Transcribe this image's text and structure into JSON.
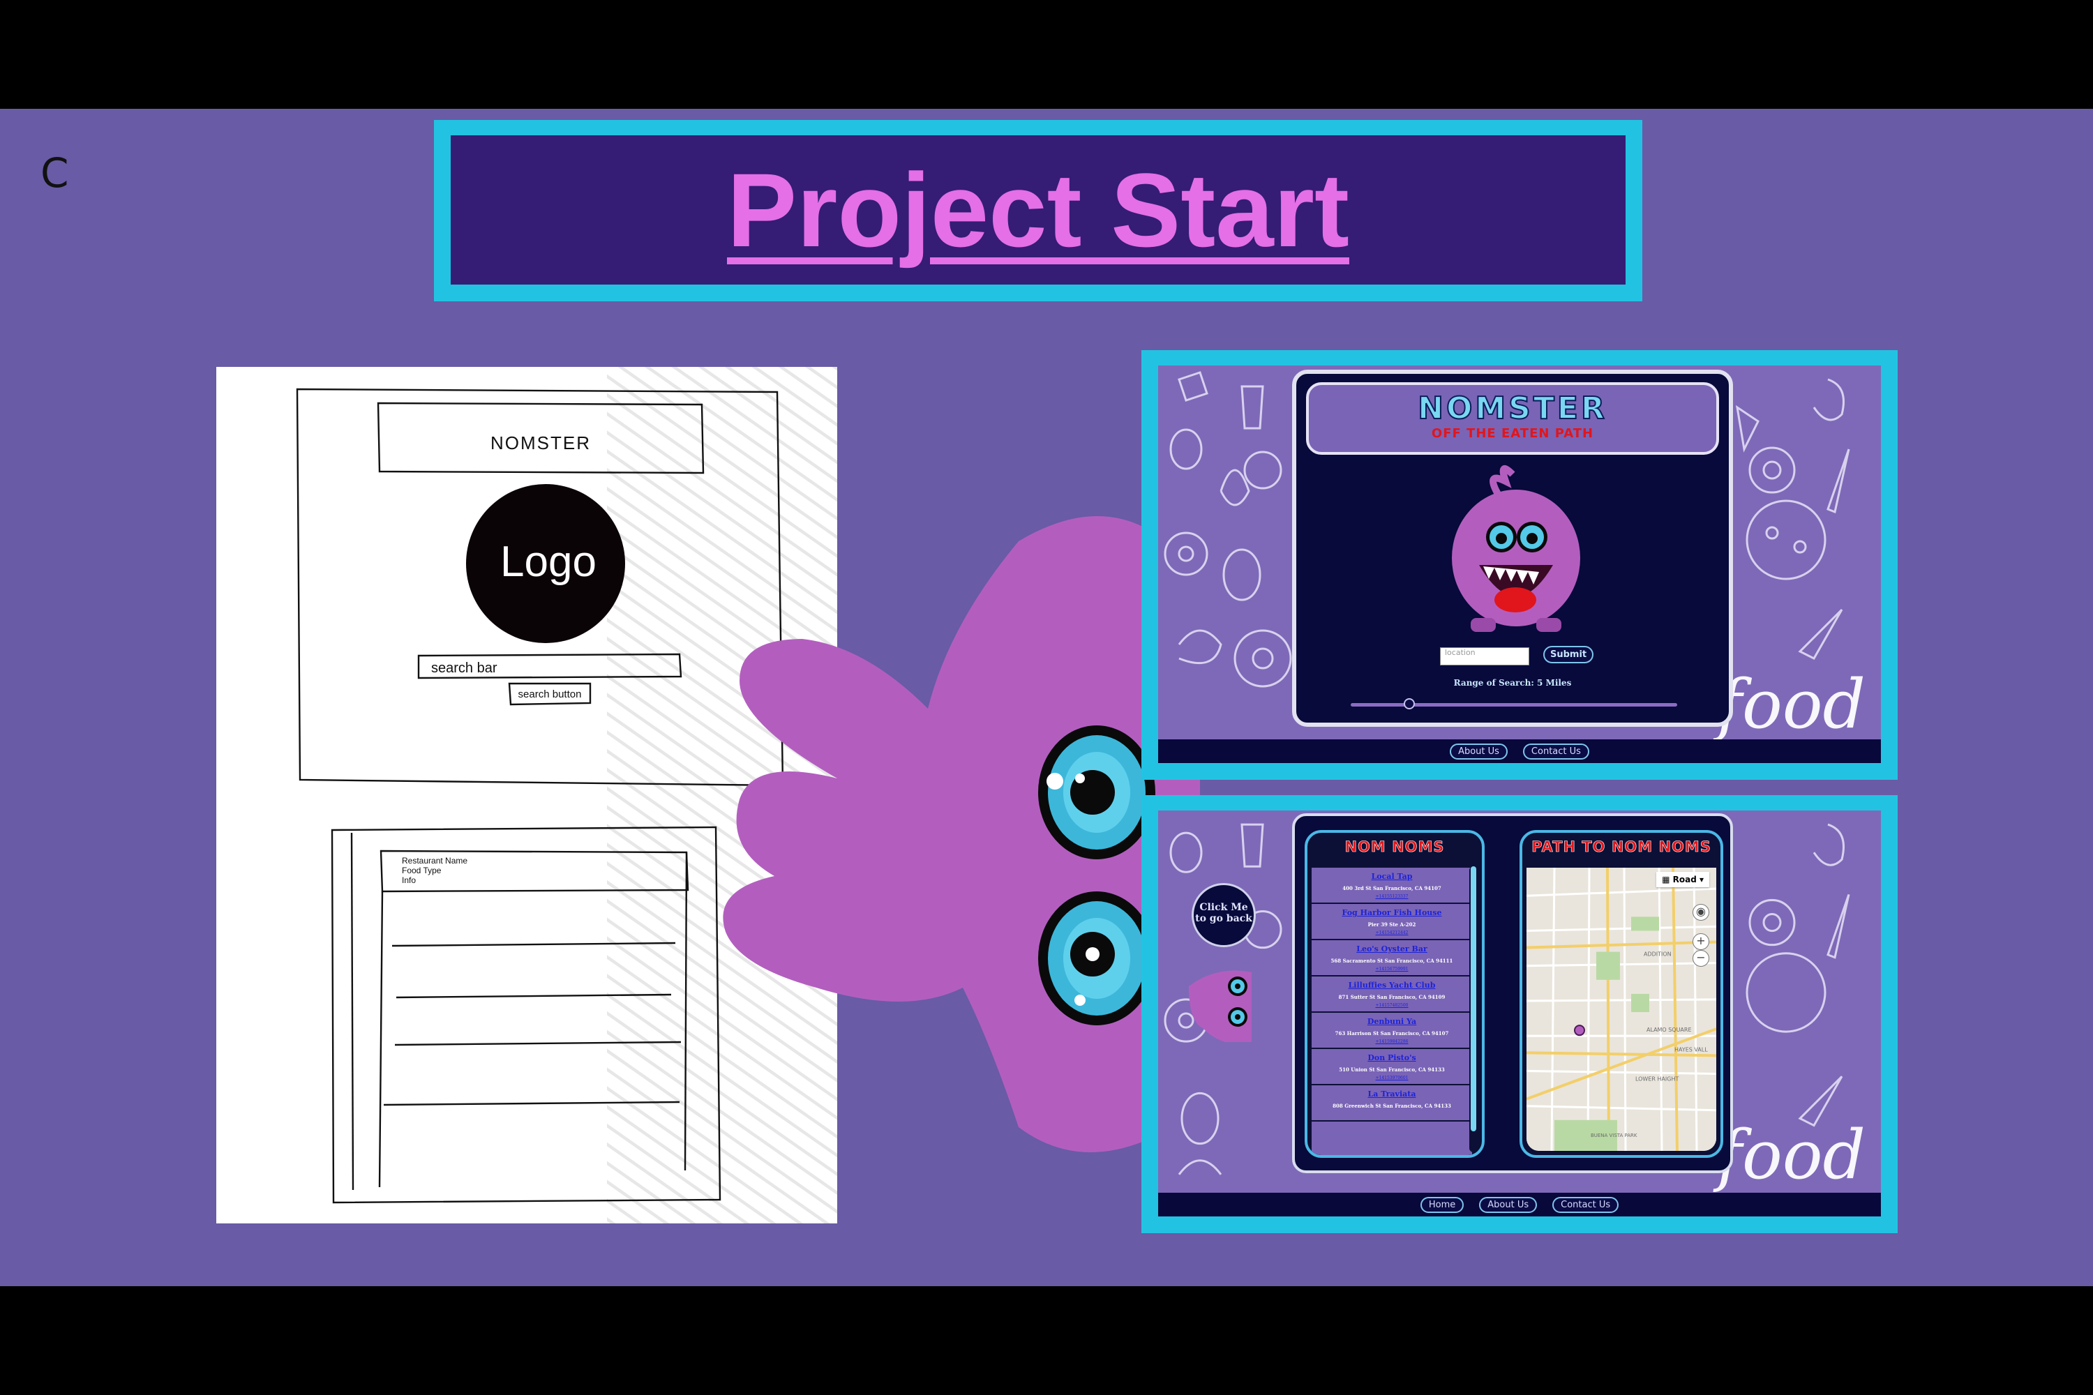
{
  "slide": {
    "corner_letter": "C",
    "title": "Project Start"
  },
  "wireframe": {
    "app_name": "NOMSTER",
    "logo_text": "Logo",
    "search_bar": "search bar",
    "search_button": "search button",
    "result_fields": [
      "Restaurant Name",
      "Food Type",
      "Info"
    ]
  },
  "home_screen": {
    "brand": "NOMSTER",
    "tagline": "OFF THE EATEN PATH",
    "location_placeholder": "location",
    "submit_label": "Submit",
    "range_text": "Range of Search: 5 Miles",
    "range_value_miles": 5,
    "decor_word": "food",
    "footer_links": [
      "About Us",
      "Contact Us"
    ]
  },
  "results_screen": {
    "list_title": "NOM NOMS",
    "map_title": "PATH TO NOM NOMS",
    "back_bubble": "Click Me to go back",
    "map_type": "Road",
    "decor_word": "food",
    "restaurants": [
      {
        "name": "Local Tap",
        "address": "400 3rd St San Francisco, CA 94107",
        "phone": "+14155123337"
      },
      {
        "name": "Fog Harbor Fish House",
        "address": "Pier 39 Ste A-202",
        "phone": "+14154212442"
      },
      {
        "name": "Leo's Oyster Bar",
        "address": "568 Sacramento St San Francisco, CA 94111",
        "phone": "+14156759991"
      },
      {
        "name": "Lilluffies Yacht Club",
        "address": "871 Sutter St San Francisco, CA 94109",
        "phone": "+14157482500"
      },
      {
        "name": "Denbuni Ya",
        "address": "763 Harrison St San Francisco, CA 94107",
        "phone": "+14159842286"
      },
      {
        "name": "Don Pisto's",
        "address": "510 Union St San Francisco, CA 94133",
        "phone": "+14153970601"
      },
      {
        "name": "La Traviata",
        "address": "808 Greenwich St San Francisco, CA 94133",
        "phone": ""
      }
    ],
    "map_labels": [
      "ADDITION",
      "ALAMO SQUARE",
      "HAYES VALL",
      "LOWER HAIGHT",
      "BUENA VISTA PARK"
    ],
    "footer_links": [
      "Home",
      "About Us",
      "Contact Us"
    ]
  },
  "colors": {
    "slide_bg": "#695ba6",
    "frame_cyan": "#22c3e2",
    "title_bg": "#351c75",
    "title_text": "#e46fe6",
    "monster_purple": "#b35ebf",
    "card_navy": "#070a3a"
  }
}
